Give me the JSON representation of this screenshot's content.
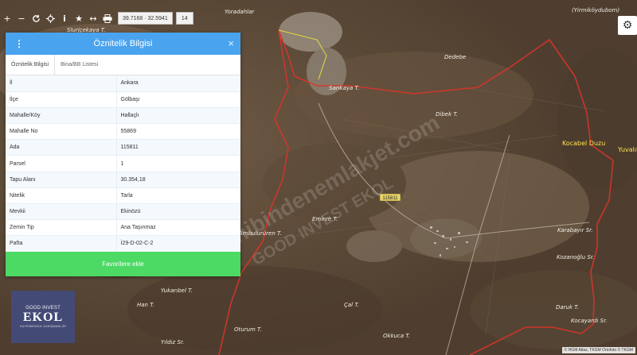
{
  "map": {
    "place_labels": [
      {
        "text": "Yoradahlar"
      },
      {
        "text": "Slurjçekaya T."
      },
      {
        "text": "Sarıkaya T."
      },
      {
        "text": "Dedebe"
      },
      {
        "text": "Dibek T."
      },
      {
        "text": "Kocabel Duzu"
      },
      {
        "text": "Yuvalık"
      },
      {
        "text": "Emirce T."
      },
      {
        "text": "Ambulurüren T."
      },
      {
        "text": "Karabayır Sr."
      },
      {
        "text": "Kozanoğlu Sr."
      },
      {
        "text": "Yukarıbel T."
      },
      {
        "text": "Han T."
      },
      {
        "text": "Çal T."
      },
      {
        "text": "Oturum T."
      },
      {
        "text": "Okkuca T."
      },
      {
        "text": "Daruk T."
      },
      {
        "text": "Kocayardı Sr."
      },
      {
        "text": "Yıldız Sr."
      },
      {
        "text": "(Yirmiköydubom)"
      }
    ],
    "parcel_tag": "115811",
    "watermarks": [
      "Sahibindenemlakjet.com",
      "GOOD INVEST EKOL"
    ]
  },
  "toolbar": {
    "coordinates": "39.7168 · 32.5941",
    "zoom": "14",
    "icons": [
      "plus-icon",
      "minus-icon",
      "refresh-icon",
      "locate-icon",
      "info-icon",
      "star-icon",
      "measure-icon",
      "print-icon"
    ]
  },
  "panel": {
    "title": "Öznitelik Bilgisi",
    "close_symbol": "×",
    "menu_symbol": "⋮",
    "tabs": [
      {
        "label": "Öznitelik Bilgisi",
        "active": true
      },
      {
        "label": "Bina/BB Listesi",
        "active": false
      }
    ],
    "rows": [
      {
        "key": "İl",
        "value": "Ankara"
      },
      {
        "key": "İlçe",
        "value": "Gölbaşı"
      },
      {
        "key": "Mahalle/Köy",
        "value": "Hallaçlı"
      },
      {
        "key": "Mahalle No",
        "value": "55869"
      },
      {
        "key": "Ada",
        "value": "115811"
      },
      {
        "key": "Parsel",
        "value": "1"
      },
      {
        "key": "Tapu Alanı",
        "value": "30.354,18"
      },
      {
        "key": "Nitelik",
        "value": "Tarla"
      },
      {
        "key": "Mevkii",
        "value": "Ekinözü"
      },
      {
        "key": "Zemin Tip",
        "value": "Ana Taşınmaz"
      },
      {
        "key": "Pafta",
        "value": "İ29-D-02-C-2"
      }
    ],
    "favorite_button": "Favorilere ekle"
  },
  "logo": {
    "top": "GOOD INVEST",
    "main": "EKOL",
    "sub": "GAYRİMENKUL DANIŞMANLIĞI"
  },
  "attribution": "© HGM Atlas, TKGM Ortofoto © TKGM",
  "colors": {
    "header_blue": "#4aa3ef",
    "favorite_green": "#4cd964",
    "boundary_red": "#d8342a"
  }
}
